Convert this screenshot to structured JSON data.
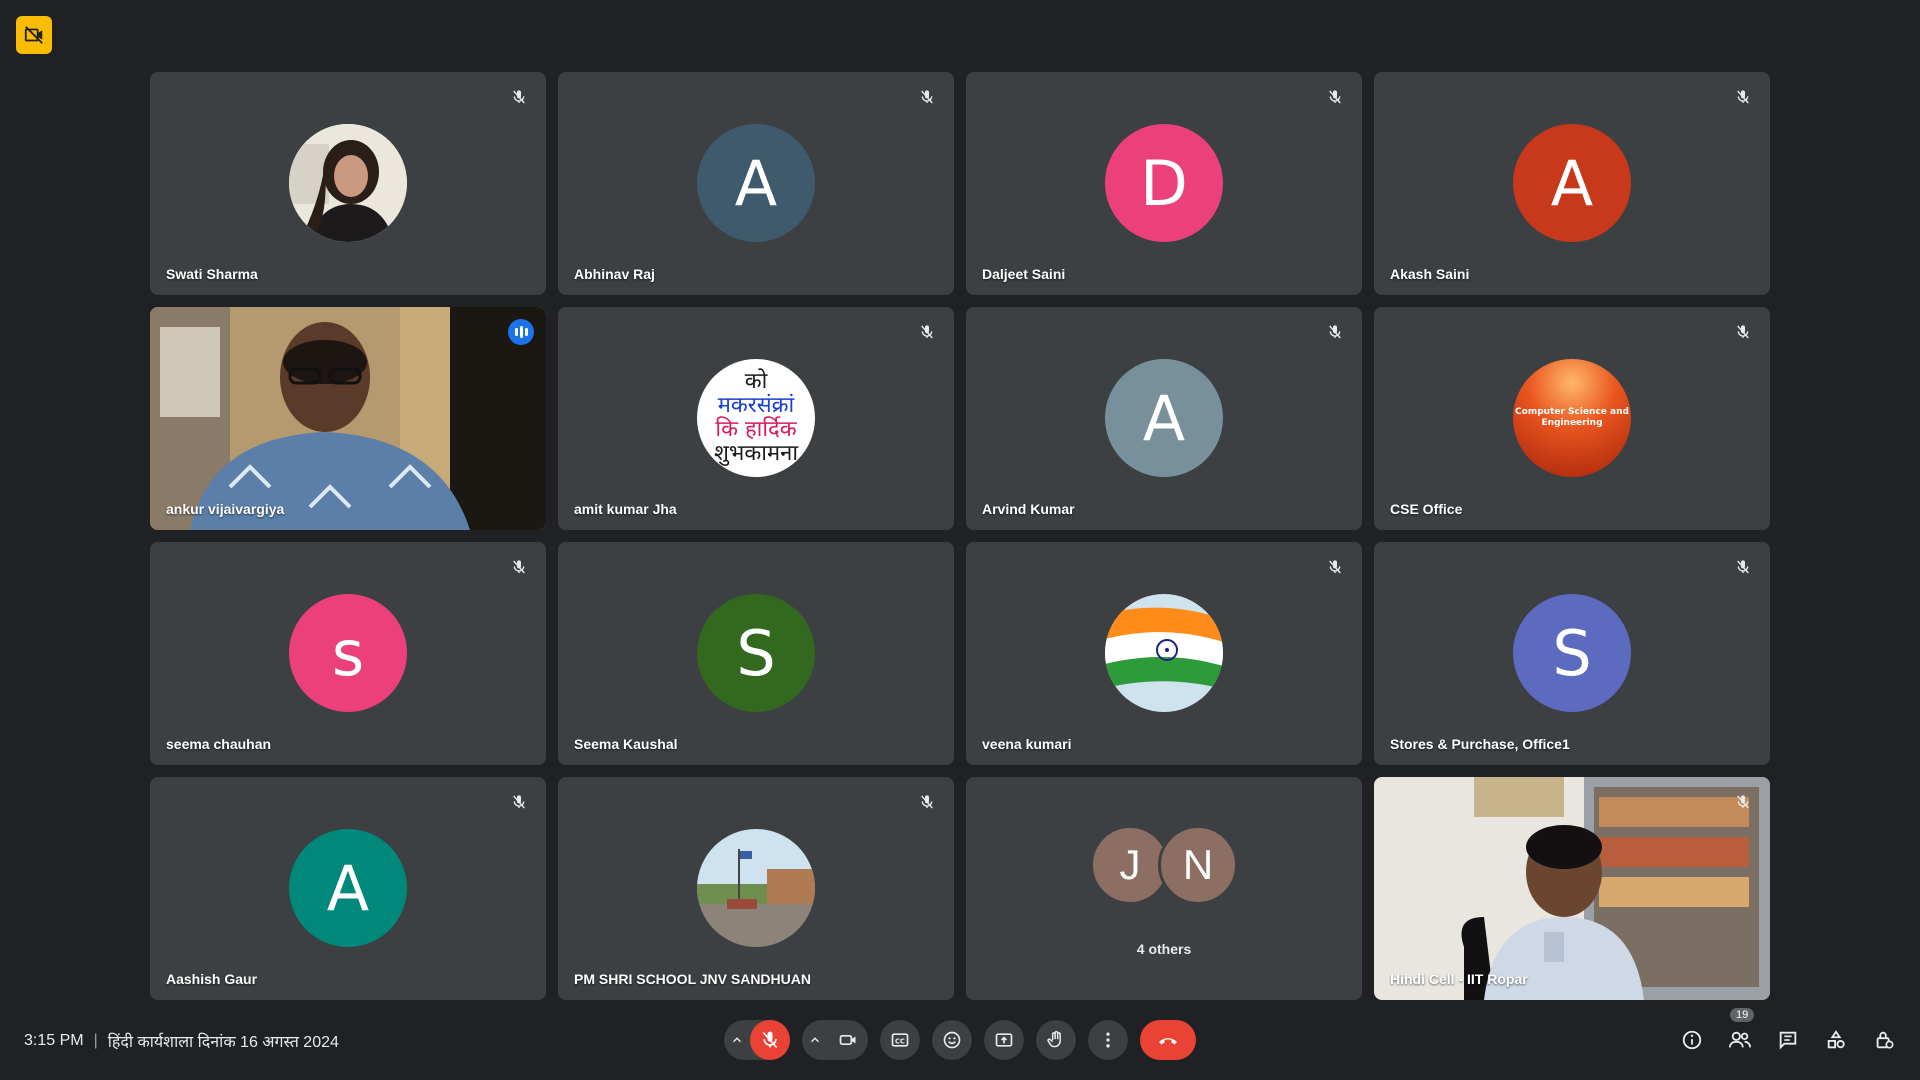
{
  "meeting": {
    "time": "3:15 PM",
    "separator": "|",
    "title": "हिंदी कार्यशाला दिनांक 16 अगस्त 2024"
  },
  "participants_count": "19",
  "tiles": [
    {
      "name": "Swati Sharma",
      "type": "photo"
    },
    {
      "name": "Abhinav Raj",
      "type": "initial",
      "initial": "A",
      "color": "#3f5a6d"
    },
    {
      "name": "Daljeet Saini",
      "type": "initial",
      "initial": "D",
      "color": "#ec407a"
    },
    {
      "name": "Akash Saini",
      "type": "initial",
      "initial": "A",
      "color": "#c8391b"
    },
    {
      "name": "ankur vijaivargiya",
      "type": "video"
    },
    {
      "name": "amit kumar Jha",
      "type": "image",
      "text_lines": [
        "को",
        "मकरसंक्रां",
        "कि हार्दिक",
        "शुभकामना"
      ]
    },
    {
      "name": "Arvind Kumar",
      "type": "initial",
      "initial": "A",
      "color": "#78909c"
    },
    {
      "name": "CSE Office",
      "type": "image",
      "text_lines": [
        "Computer Science and",
        "Engineering"
      ]
    },
    {
      "name": "seema chauhan",
      "type": "initial",
      "initial": "s",
      "color": "#ec407a"
    },
    {
      "name": "Seema Kaushal",
      "type": "initial",
      "initial": "S",
      "color": "#33691e"
    },
    {
      "name": "veena kumari",
      "type": "image"
    },
    {
      "name": "Stores & Purchase, Office1",
      "type": "initial",
      "initial": "S",
      "color": "#5c6bc0"
    },
    {
      "name": "Aashish Gaur",
      "type": "initial",
      "initial": "A",
      "color": "#00897b"
    },
    {
      "name": "PM SHRI SCHOOL JNV SANDHUAN",
      "type": "image"
    },
    {
      "name": "4 others",
      "type": "others",
      "initials": [
        "J",
        "N"
      ],
      "colors": [
        "#8d6e63",
        "#8d6e63"
      ]
    },
    {
      "name": "Hindi Cell - IIT Ropar",
      "type": "video"
    }
  ],
  "icons": {
    "recording": "no-video-icon",
    "mic": "mic-off-icon",
    "camera": "camera-icon",
    "captions": "captions-icon",
    "emoji": "emoji-icon",
    "present": "present-icon",
    "hand": "raise-hand-icon",
    "more": "more-vert-icon",
    "leave": "call-end-icon",
    "info": "info-icon",
    "people": "people-icon",
    "chat": "chat-icon",
    "activities": "activities-icon",
    "host": "host-controls-icon"
  },
  "colors": {
    "background": "#202124",
    "tile": "#3c4043",
    "accent": "#8ab4f8",
    "danger": "#ea4335",
    "recording_badge": "#fbbc04"
  }
}
